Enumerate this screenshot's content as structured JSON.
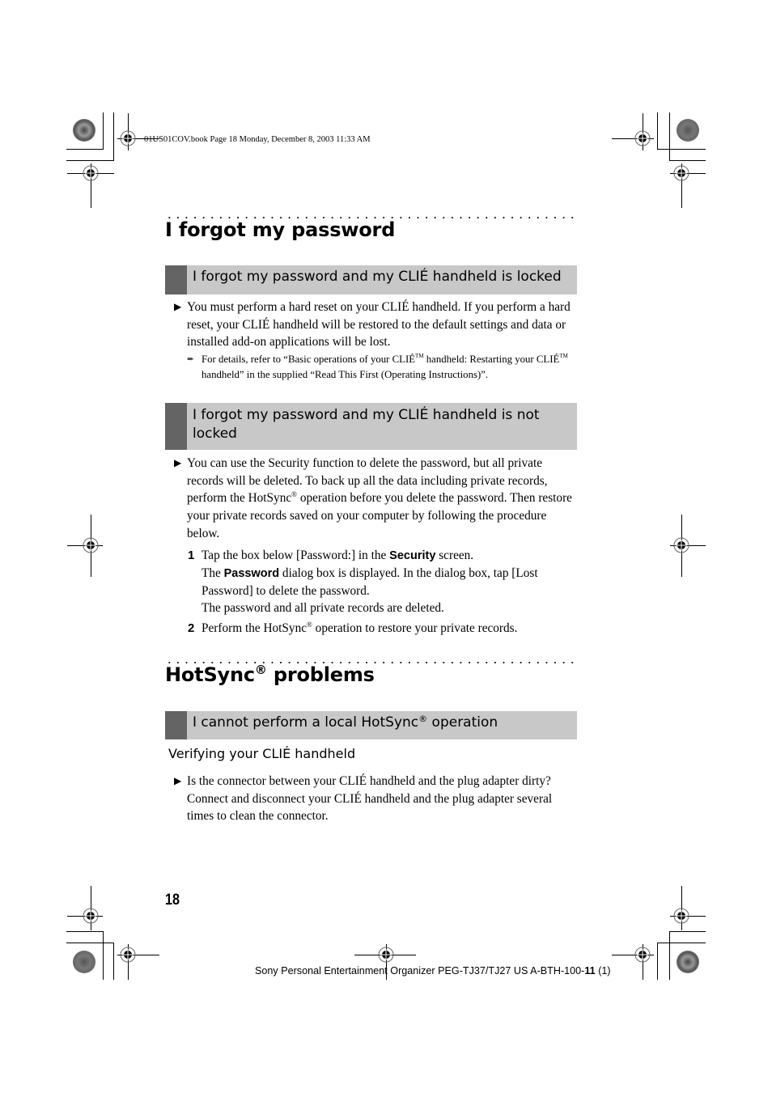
{
  "header_line": "01US01COV.book  Page 18  Monday, December 8, 2003  11:33 AM",
  "section1": {
    "title": "I forgot my password",
    "sub1": {
      "title": "I forgot my password and my CLIÉ handheld is locked",
      "para": "You must perform a hard reset on your CLIÉ handheld. If you perform a hard reset, your CLIÉ handheld will be restored to the default settings and data or installed add-on applications will be lost.",
      "note_a": "For details, refer to “Basic operations of your CLIÉ",
      "note_tm1": "TM",
      "note_b": " handheld: Restarting your CLIÉ",
      "note_tm2": "TM",
      "note_c": " handheld” in the supplied “Read This First (Operating Instructions)”."
    },
    "sub2": {
      "title": "I forgot my password and my CLIÉ handheld is not locked",
      "para_a": "You can use the Security function to delete the password, but all private records will be deleted. To back up all the data including private records, perform the HotSync",
      "para_reg": "®",
      "para_b": " operation before you delete the password. Then restore your private records saved on your computer by following the procedure below.",
      "steps": [
        {
          "num": "1",
          "l1_a": "Tap the box below [Password:] in the ",
          "l1_bold": "Security",
          "l1_b": " screen.",
          "l2_a": "The ",
          "l2_bold": "Password",
          "l2_b": " dialog box is displayed. In the dialog box, tap [Lost Password] to delete the password.",
          "l3": "The password and all private records are deleted."
        },
        {
          "num": "2",
          "a": "Perform the HotSync",
          "reg": "®",
          "b": " operation to restore your private records."
        }
      ]
    }
  },
  "section2": {
    "title_a": "HotSync",
    "title_reg": "®",
    "title_b": " problems",
    "sub1": {
      "title_a": "I cannot perform a local HotSync",
      "title_reg": "®",
      "title_b": " operation",
      "subhead": "Verifying your CLIÉ handheld",
      "para": "Is the connector between your CLIÉ handheld and the plug adapter dirty? Connect and disconnect your CLIÉ handheld and the plug adapter several times to clean the connector."
    }
  },
  "bullet_glyph": "▶",
  "note_glyph": "➨",
  "page_number": "18",
  "footer": {
    "text_a": "Sony Personal Entertainment Organizer PEG-TJ37/TJ27 US  A-BTH-100-",
    "text_bold": "11",
    "text_b": " (1)"
  },
  "colors": {
    "bar_fill": "#c8c8c8",
    "bar_tab": "#646464"
  }
}
